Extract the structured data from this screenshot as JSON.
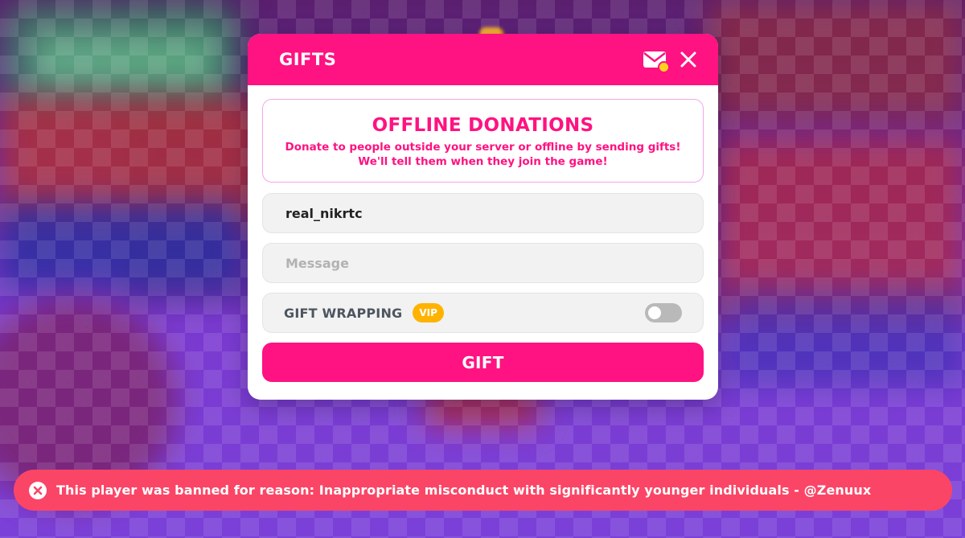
{
  "modal": {
    "title": "GIFTS",
    "info": {
      "title": "OFFLINE DONATIONS",
      "description": "Donate to people outside your server or offline by sending gifts! We'll tell them when they join the game!"
    },
    "recipient": {
      "value": "real_nikrtc"
    },
    "message": {
      "value": "",
      "placeholder": "Message"
    },
    "gift_wrapping": {
      "label": "GIFT WRAPPING",
      "badge": "VIP",
      "enabled": false
    },
    "gift_button_label": "GIFT",
    "icons": {
      "mail": "mail-icon",
      "close": "close-icon"
    }
  },
  "toast": {
    "text": "This player was banned for reason: Inappropriate misconduct with significantly younger individuals - @Zenuux",
    "icon": "error-circle-icon",
    "color": "#fb4566"
  },
  "colors": {
    "accent": "#ff1281",
    "vip": "#ffb300",
    "notification_dot": "#ffd21f"
  }
}
